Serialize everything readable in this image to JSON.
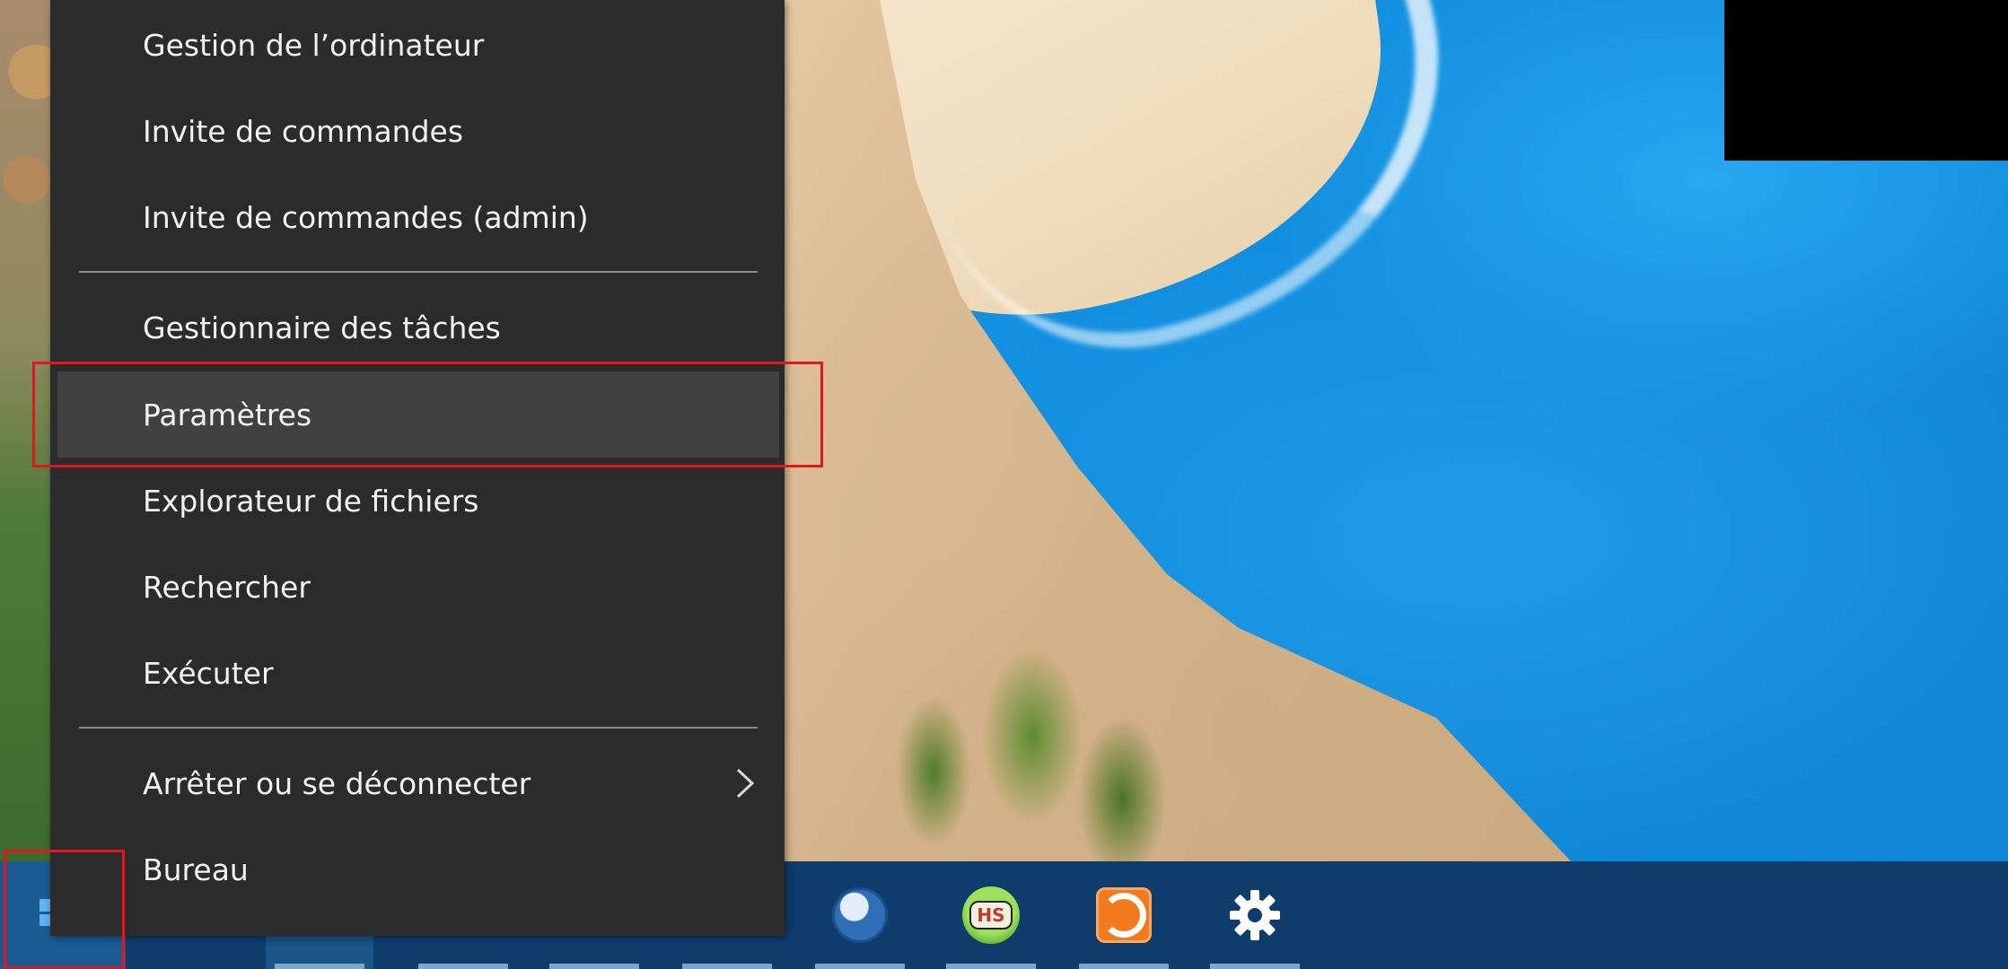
{
  "desktop": {
    "wallpaper_icon": "seaside-cliff-photo"
  },
  "context_menu": {
    "items": [
      {
        "label": "Gestion de l’ordinateur"
      },
      {
        "label": "Invite de commandes"
      },
      {
        "label": "Invite de commandes (admin)"
      },
      {
        "label": "Gestionnaire des tâches"
      },
      {
        "label": "Paramètres",
        "highlighted": true
      },
      {
        "label": "Explorateur de fichiers"
      },
      {
        "label": "Rechercher"
      },
      {
        "label": "Exécuter"
      },
      {
        "label": "Arrêter ou se déconnecter",
        "has_submenu": true
      },
      {
        "label": "Bureau"
      }
    ]
  },
  "taskbar": {
    "start_icon": "windows-logo-icon",
    "pinned_apps": [
      {
        "name": "thunderbird-icon"
      },
      {
        "name": "hs-icon",
        "label": "HS"
      },
      {
        "name": "orange-app-icon"
      },
      {
        "name": "gear-icon"
      }
    ]
  },
  "colors": {
    "menu_background": "#2b2b2b",
    "menu_hover": "#414141",
    "menu_text": "#f2f2f2",
    "taskbar": "#0e3c6b",
    "annotation_red": "#e3161f"
  }
}
